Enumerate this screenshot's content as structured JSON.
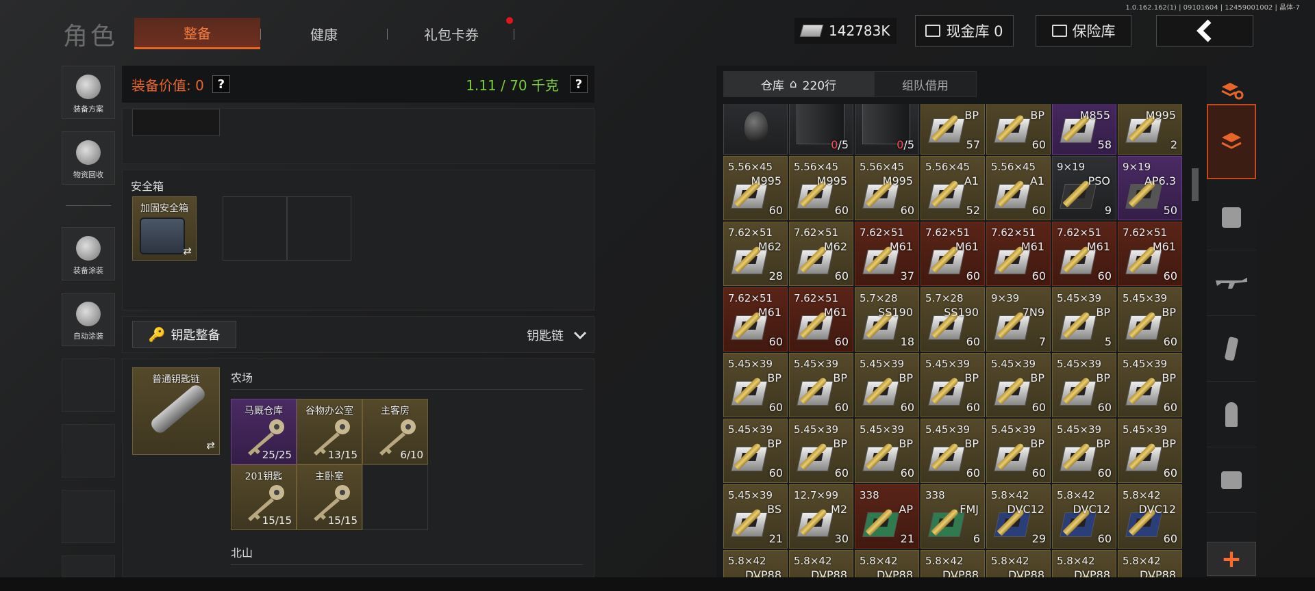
{
  "build_info": "1.0.162.162(1) | 09101604 | 12459001002 | 晶体-7",
  "header": {
    "title": "角色",
    "tabs": [
      {
        "label": "整备",
        "active": true
      },
      {
        "label": "健康",
        "active": false
      },
      {
        "label": "礼包卡券",
        "active": false,
        "badge": true
      }
    ],
    "money": "142783K",
    "cash_vault": "现金库 0",
    "insured_vault": "保险库",
    "back_icon": "chevron-left-icon"
  },
  "left_nav": [
    {
      "label": "装备方案",
      "icon": "helmet-grid-icon"
    },
    {
      "label": "物资回收",
      "icon": "recycle-face-icon"
    },
    {
      "label": "装备涂装",
      "icon": "helmet-paint-icon"
    },
    {
      "label": "自动涂装",
      "icon": "brush-gear-icon"
    }
  ],
  "equip": {
    "value_label": "装备价值: 0",
    "weight": "1.11 / 70 千克",
    "help": "?"
  },
  "safe_box": {
    "section": "安全箱",
    "item": "加固安全箱",
    "swap": "⇄"
  },
  "keys": {
    "button": "钥匙整备",
    "chain_label": "钥匙链",
    "keychain_item": "普通钥匙链",
    "swap": "⇄",
    "farm_section": "农场",
    "north_section": "北山",
    "items": [
      {
        "name": "马厩仓库",
        "count": "25/25",
        "color": "purple"
      },
      {
        "name": "谷物办公室",
        "count": "13/15",
        "color": "gold"
      },
      {
        "name": "主客房",
        "count": "6/10",
        "color": "gold"
      },
      {
        "name": "201钥匙",
        "count": "15/15",
        "color": "gold"
      },
      {
        "name": "主卧室",
        "count": "15/15",
        "color": "gold"
      }
    ]
  },
  "warehouse": {
    "tabs": [
      {
        "label": "仓库",
        "rows": "220行",
        "active": true
      },
      {
        "label": "组队借用",
        "active": false
      }
    ],
    "cells": [
      {
        "cal": "",
        "var": "",
        "count": "",
        "color": "dark",
        "type": "grenade"
      },
      {
        "cal": "",
        "var": "",
        "count": "0/5",
        "color": "dark",
        "type": "mag"
      },
      {
        "cal": "",
        "var": "",
        "count": "0/5",
        "color": "dark",
        "type": "mag"
      },
      {
        "cal": "",
        "var": "BP",
        "count": "57",
        "color": "gold"
      },
      {
        "cal": "",
        "var": "BP",
        "count": "60",
        "color": "gold"
      },
      {
        "cal": "",
        "var": "M855",
        "count": "58",
        "color": "purple"
      },
      {
        "cal": "",
        "var": "M995",
        "count": "2",
        "color": "gold"
      },
      {
        "cal": "5.56×45",
        "var": "M995",
        "count": "60",
        "color": "gold"
      },
      {
        "cal": "5.56×45",
        "var": "M995",
        "count": "60",
        "color": "gold"
      },
      {
        "cal": "5.56×45",
        "var": "M995",
        "count": "60",
        "color": "gold"
      },
      {
        "cal": "5.56×45",
        "var": "A1",
        "count": "52",
        "color": "gold"
      },
      {
        "cal": "5.56×45",
        "var": "A1",
        "count": "60",
        "color": "gold"
      },
      {
        "cal": "9×19",
        "var": "PSO",
        "count": "9",
        "color": "dark"
      },
      {
        "cal": "9×19",
        "var": "AP6.3",
        "count": "50",
        "color": "purple"
      },
      {
        "cal": "7.62×51",
        "var": "M62",
        "count": "28",
        "color": "gold"
      },
      {
        "cal": "7.62×51",
        "var": "M62",
        "count": "60",
        "color": "gold"
      },
      {
        "cal": "7.62×51",
        "var": "M61",
        "count": "37",
        "color": "red"
      },
      {
        "cal": "7.62×51",
        "var": "M61",
        "count": "60",
        "color": "red"
      },
      {
        "cal": "7.62×51",
        "var": "M61",
        "count": "60",
        "color": "red"
      },
      {
        "cal": "7.62×51",
        "var": "M61",
        "count": "60",
        "color": "red"
      },
      {
        "cal": "7.62×51",
        "var": "M61",
        "count": "60",
        "color": "red"
      },
      {
        "cal": "7.62×51",
        "var": "M61",
        "count": "60",
        "color": "red"
      },
      {
        "cal": "7.62×51",
        "var": "M61",
        "count": "60",
        "color": "red"
      },
      {
        "cal": "5.7×28",
        "var": "SS190",
        "count": "18",
        "color": "gold"
      },
      {
        "cal": "5.7×28",
        "var": "SS190",
        "count": "60",
        "color": "gold"
      },
      {
        "cal": "9×39",
        "var": "7N9",
        "count": "7",
        "color": "gold"
      },
      {
        "cal": "5.45×39",
        "var": "BP",
        "count": "5",
        "color": "gold"
      },
      {
        "cal": "5.45×39",
        "var": "BP",
        "count": "60",
        "color": "gold"
      },
      {
        "cal": "5.45×39",
        "var": "BP",
        "count": "60",
        "color": "gold"
      },
      {
        "cal": "5.45×39",
        "var": "BP",
        "count": "60",
        "color": "gold"
      },
      {
        "cal": "5.45×39",
        "var": "BP",
        "count": "60",
        "color": "gold"
      },
      {
        "cal": "5.45×39",
        "var": "BP",
        "count": "60",
        "color": "gold"
      },
      {
        "cal": "5.45×39",
        "var": "BP",
        "count": "60",
        "color": "gold"
      },
      {
        "cal": "5.45×39",
        "var": "BP",
        "count": "60",
        "color": "gold"
      },
      {
        "cal": "5.45×39",
        "var": "BP",
        "count": "60",
        "color": "gold"
      },
      {
        "cal": "5.45×39",
        "var": "BP",
        "count": "60",
        "color": "gold"
      },
      {
        "cal": "5.45×39",
        "var": "BP",
        "count": "60",
        "color": "gold"
      },
      {
        "cal": "5.45×39",
        "var": "BP",
        "count": "60",
        "color": "gold"
      },
      {
        "cal": "5.45×39",
        "var": "BP",
        "count": "60",
        "color": "gold"
      },
      {
        "cal": "5.45×39",
        "var": "BP",
        "count": "60",
        "color": "gold"
      },
      {
        "cal": "5.45×39",
        "var": "BP",
        "count": "60",
        "color": "gold"
      },
      {
        "cal": "5.45×39",
        "var": "BP",
        "count": "60",
        "color": "gold"
      },
      {
        "cal": "5.45×39",
        "var": "BS",
        "count": "21",
        "color": "gold"
      },
      {
        "cal": "12.7×99",
        "var": "M2",
        "count": "30",
        "color": "gold"
      },
      {
        "cal": "338",
        "var": "AP",
        "count": "21",
        "color": "red"
      },
      {
        "cal": "338",
        "var": "FMJ",
        "count": "6",
        "color": "gold"
      },
      {
        "cal": "5.8×42",
        "var": "DVC12",
        "count": "29",
        "color": "gold"
      },
      {
        "cal": "5.8×42",
        "var": "DVC12",
        "count": "60",
        "color": "gold"
      },
      {
        "cal": "5.8×42",
        "var": "DVC12",
        "count": "60",
        "color": "gold"
      },
      {
        "cal": "5.8×42",
        "var": "DVP88",
        "count": "",
        "color": "gold"
      },
      {
        "cal": "5.8×42",
        "var": "DVP88",
        "count": "",
        "color": "gold"
      },
      {
        "cal": "5.8×42",
        "var": "DVP88",
        "count": "",
        "color": "gold"
      },
      {
        "cal": "5.8×42",
        "var": "DVP88",
        "count": "",
        "color": "gold"
      },
      {
        "cal": "5.8×42",
        "var": "DVP88",
        "count": "",
        "color": "gold"
      },
      {
        "cal": "5.8×42",
        "var": "DVP88",
        "count": "",
        "color": "gold"
      },
      {
        "cal": "5.8×42",
        "var": "DVP88",
        "count": "",
        "color": "gold"
      }
    ]
  },
  "filters": [
    {
      "icon": "stack-refresh-icon"
    },
    {
      "icon": "stack-all-icon",
      "selected": true
    },
    {
      "icon": "vest-icon"
    },
    {
      "icon": "rifle-icon"
    },
    {
      "icon": "magazine-icon"
    },
    {
      "icon": "ammo-icon"
    },
    {
      "icon": "scope-icon"
    }
  ],
  "add_button": "+",
  "colors": {
    "accent": "#e8652a",
    "weight_green": "#7ccf33",
    "purple": "#4a2a63",
    "gold": "#55492a",
    "red": "#5a2418"
  }
}
